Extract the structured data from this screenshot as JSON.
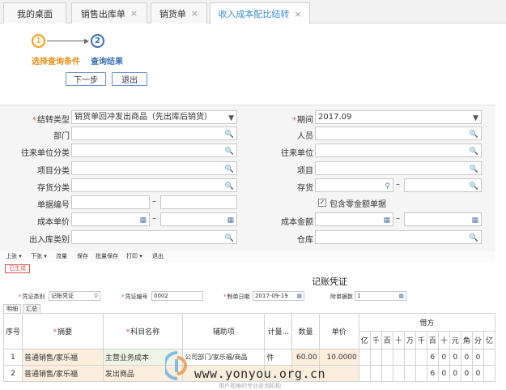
{
  "tabs": [
    {
      "label": "我的桌面",
      "closable": false
    },
    {
      "label": "销售出库单",
      "closable": true
    },
    {
      "label": "销货单",
      "closable": true
    },
    {
      "label": "收入成本配比结转",
      "closable": true,
      "active": true
    }
  ],
  "close_glyph": "×",
  "steps": [
    {
      "number": "1",
      "label": "选择查询条件"
    },
    {
      "number": "2",
      "label": "查询结果"
    }
  ],
  "buttons": {
    "next": "下一步",
    "exit": "退出"
  },
  "form": {
    "transfer_type": {
      "label": "结转类型",
      "value": "销货单回冲发出商品（先出库后销货）"
    },
    "period": {
      "label": "期间",
      "value": "2017.09"
    },
    "department": {
      "label": "部门"
    },
    "staff": {
      "label": "人员"
    },
    "partner_category": {
      "label": "往来单位分类"
    },
    "partner": {
      "label": "往来单位"
    },
    "project_category": {
      "label": "项目分类"
    },
    "project": {
      "label": "项目"
    },
    "inventory_category": {
      "label": "存货分类"
    },
    "inventory": {
      "label": "存货"
    },
    "doc_number": {
      "label": "单据编号"
    },
    "include_zero": {
      "label": "包含零金额单据",
      "checked": true
    },
    "unit_cost": {
      "label": "成本单价"
    },
    "cost_amount": {
      "label": "成本金额"
    },
    "io_type": {
      "label": "出入库类别"
    },
    "warehouse": {
      "label": "仓库"
    },
    "range_sep": "–"
  },
  "toolbar": [
    "上张 ▾",
    "下张 ▾",
    "流量",
    "保存",
    "批量保存",
    "打印 ▾",
    "退出"
  ],
  "voucher": {
    "status": "已生成",
    "title": "记账凭证",
    "voucher_type": {
      "label": "凭证类别",
      "value": "记账凭证"
    },
    "voucher_no": {
      "label": "凭证编号",
      "value": "0002"
    },
    "made_date": {
      "label": "制单日期",
      "value": "2017-09-19"
    },
    "attachments": {
      "label": "附单据数",
      "value": "1"
    },
    "subtabs": [
      "明细",
      "汇总"
    ],
    "columns": {
      "seq": "序号",
      "summary": "摘要",
      "account": "科目名称",
      "aux": "辅助项",
      "unit": "计量...",
      "qty": "数量",
      "price": "单价",
      "debit": "借方"
    },
    "digit_headers": [
      "亿",
      "千",
      "百",
      "十",
      "万",
      "千",
      "百",
      "十",
      "元",
      "角",
      "分",
      "亿"
    ],
    "rows": [
      {
        "seq": "1",
        "summary": "普通销售/家乐福",
        "account": "主营业务成本",
        "aux": "公司部门/家乐福/商品",
        "unit": "件",
        "qty": "60.00",
        "price": "10.0000",
        "digits": [
          "",
          "",
          "",
          "",
          "",
          "",
          "6",
          "0",
          "0",
          "0",
          "0",
          ""
        ]
      },
      {
        "seq": "2",
        "summary": "普通销售/家乐福",
        "account": "发出商品",
        "aux": "",
        "unit": "",
        "qty": "",
        "price": "",
        "digits": [
          "",
          "",
          "",
          "",
          "",
          "",
          "6",
          "0",
          "0",
          "0",
          "0",
          ""
        ]
      }
    ]
  },
  "watermark": {
    "url": "www.yonyou.org.cn",
    "tagline": "用户视角的专业咨询机构"
  },
  "colors": {
    "accent": "#3b8fd5",
    "step_active": "#f0a020",
    "step_inactive": "#3d6fb0",
    "required": "#d9534f"
  }
}
